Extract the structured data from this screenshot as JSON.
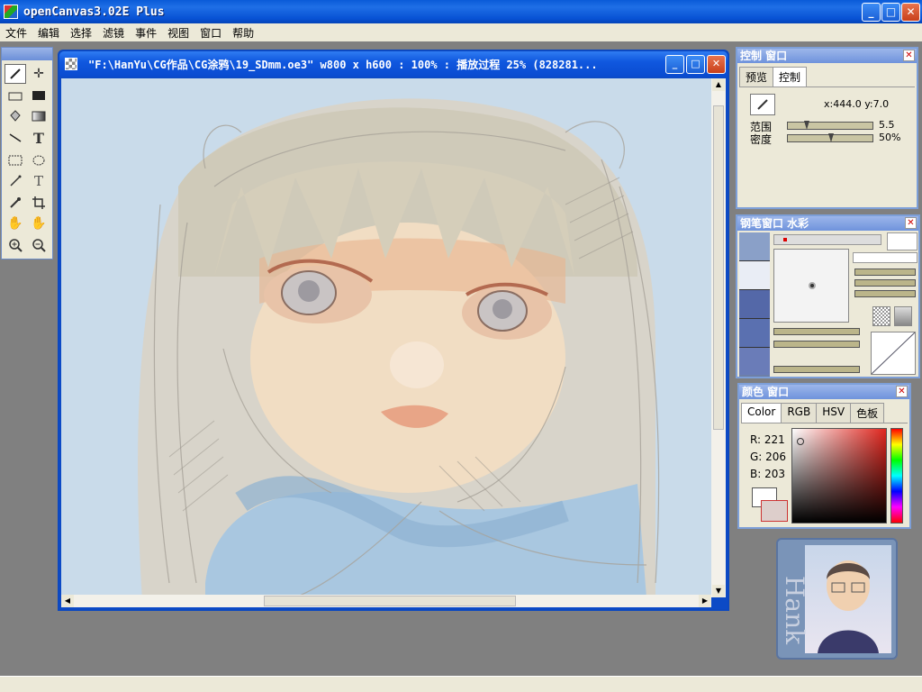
{
  "app": {
    "title": "openCanvas3.02E Plus"
  },
  "menu": [
    "文件",
    "编辑",
    "选择",
    "滤镜",
    "事件",
    "视图",
    "窗口",
    "帮助"
  ],
  "window_buttons": {
    "minimize": "_",
    "maximize": "□",
    "close": "✕"
  },
  "tools": [
    "pen-tool",
    "move-tool",
    "brush-tool",
    "fill-rect-tool",
    "bucket-tool",
    "gradient-tool",
    "line-tool",
    "text-tool",
    "rect-select-tool",
    "lasso-tool",
    "wand-tool",
    "text-select-tool",
    "eyedropper-tool",
    "crop-tool",
    "hand-tool",
    "rotate-hand-tool",
    "zoom-in-tool",
    "zoom-out-tool"
  ],
  "canvas": {
    "title": "\"F:\\HanYu\\CG作品\\CG涂鸦\\19_SDmm.oe3\" w800 x h600 : 100% : 播放过程 25% (828281...",
    "bg_color": "#c9dbea"
  },
  "control_panel": {
    "title": "控制 窗口",
    "tabs": [
      "预览",
      "控制"
    ],
    "active_tab": "控制",
    "coords": "x:444.0  y:7.0",
    "range_label": "范围",
    "range_value": "5.5",
    "density_label": "密度",
    "density_value": "50%"
  },
  "pen_panel": {
    "title": "钢笔窗口  水彩"
  },
  "color_panel": {
    "title": "颜色 窗口",
    "tabs": [
      "Color",
      "RGB",
      "HSV",
      "色板"
    ],
    "active_tab": "Color",
    "r": "R: 221",
    "g": "G: 206",
    "b": "B: 203",
    "current_color": "#ddcecb"
  },
  "avatar_card": {
    "name": "Hank"
  }
}
